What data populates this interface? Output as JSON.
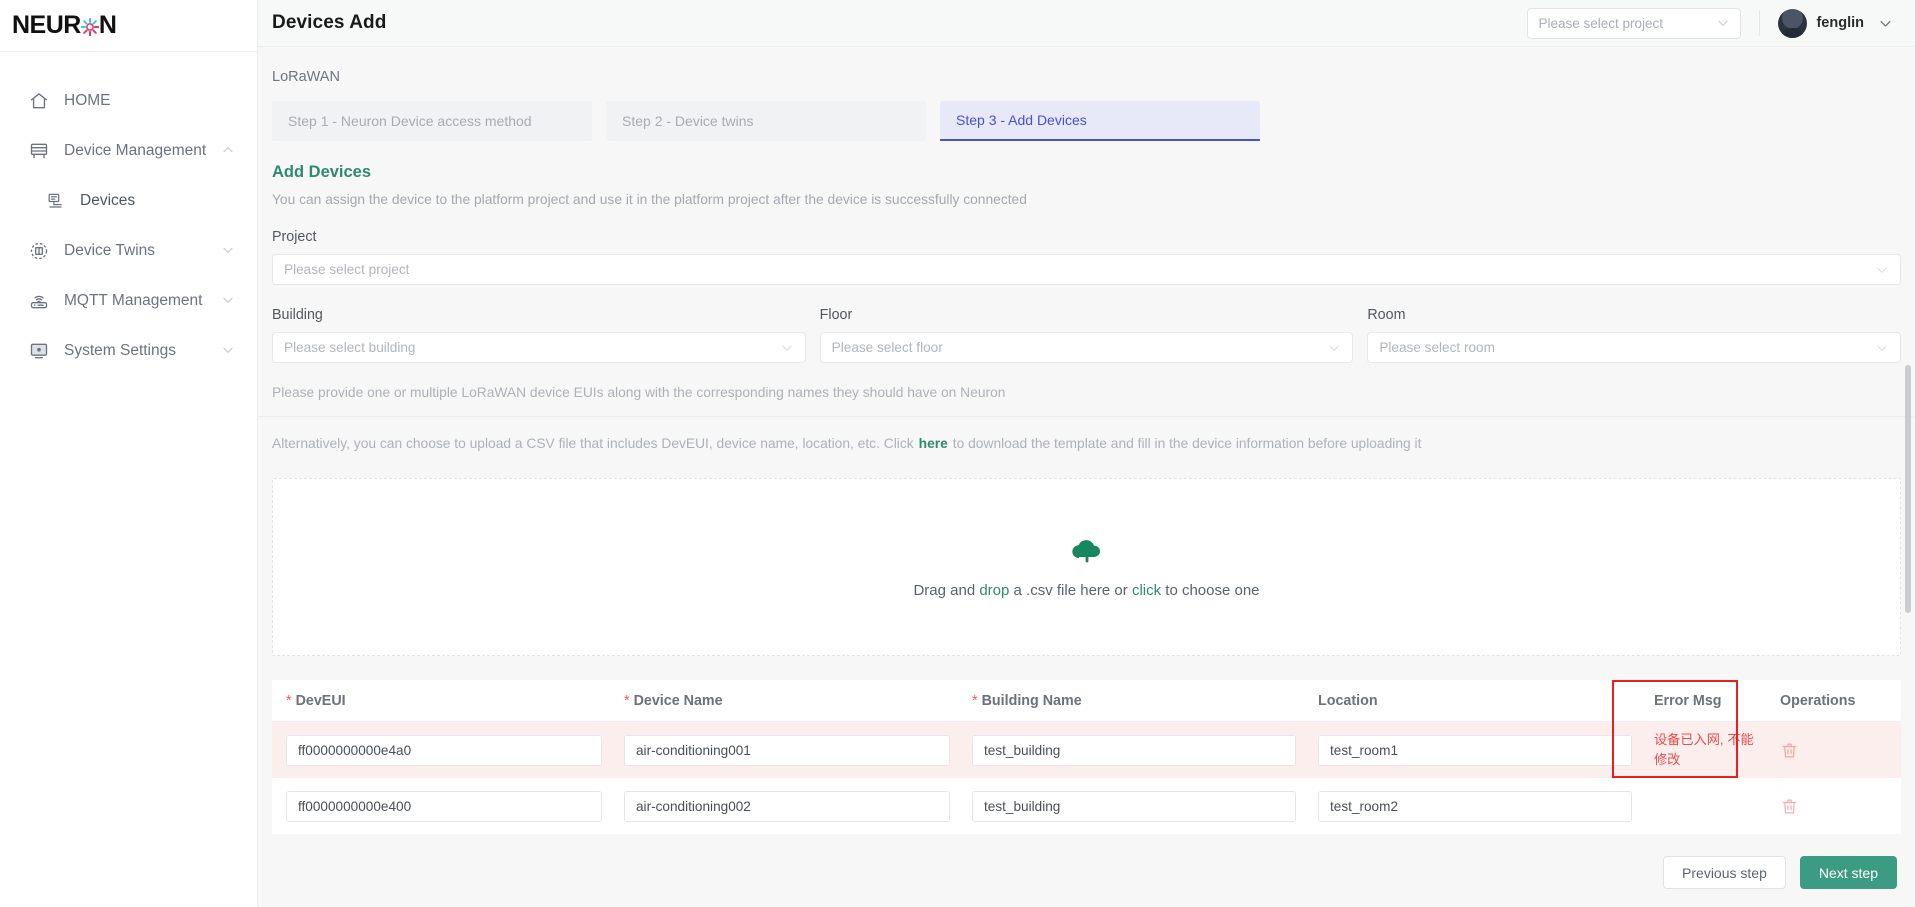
{
  "brand": {
    "name_part1": "NEUR",
    "name_part2": "N",
    "spark_icon": "gear-spark-icon"
  },
  "sidebar": {
    "items": [
      {
        "label": "HOME",
        "icon": "home-icon",
        "expandable": false,
        "sub": false
      },
      {
        "label": "Device Management",
        "icon": "device-management-icon",
        "expandable": true,
        "chevron": "chevron-up-icon",
        "sub": false
      },
      {
        "label": "Devices",
        "icon": "devices-icon",
        "expandable": false,
        "sub": true
      },
      {
        "label": "Device Twins",
        "icon": "device-twins-icon",
        "expandable": true,
        "chevron": "chevron-down-icon",
        "sub": false
      },
      {
        "label": "MQTT Management",
        "icon": "mqtt-icon",
        "expandable": true,
        "chevron": "chevron-down-icon",
        "sub": false
      },
      {
        "label": "System Settings",
        "icon": "system-settings-icon",
        "expandable": true,
        "chevron": "chevron-down-icon",
        "sub": false
      }
    ]
  },
  "topbar": {
    "title": "Devices Add",
    "project_select_placeholder": "Please select project",
    "project_select_value": "",
    "username": "fenglin",
    "chevron_icon": "chevron-down-icon",
    "avatar_icon": "avatar"
  },
  "breadcrumb": "LoRaWAN",
  "steps": [
    {
      "label": "Step 1 - Neuron Device access method",
      "active": false
    },
    {
      "label": "Step 2 - Device twins",
      "active": false
    },
    {
      "label": "Step 3 - Add Devices",
      "active": true
    }
  ],
  "section": {
    "title": "Add Devices",
    "subtitle": "You can assign the device to the platform project and use it in the platform project after the device is successfully connected"
  },
  "form": {
    "project": {
      "label": "Project",
      "placeholder": "Please select project",
      "value": ""
    },
    "building": {
      "label": "Building",
      "placeholder": "Please select building",
      "value": ""
    },
    "floor": {
      "label": "Floor",
      "placeholder": "Please select floor",
      "value": ""
    },
    "room": {
      "label": "Room",
      "placeholder": "Please select room",
      "value": ""
    }
  },
  "hints": {
    "line1": "Please provide one or multiple LoRaWAN device EUIs along with the corresponding names they should have on Neuron",
    "line2_before": "Alternatively, you can choose to upload a CSV file that includes DevEUI, device name, location, etc. Click",
    "line2_link": "here",
    "line2_after": "to download the template and fill in the device information before uploading it"
  },
  "dropzone": {
    "icon": "cloud-upload-icon",
    "text_part1": "Drag and ",
    "text_drop": "drop",
    "text_part2": " a .csv file here or ",
    "text_click": "click",
    "text_part3": " to choose one"
  },
  "table": {
    "columns": [
      {
        "label": "DevEUI",
        "required": true
      },
      {
        "label": "Device Name",
        "required": true
      },
      {
        "label": "Building Name",
        "required": true
      },
      {
        "label": "Location",
        "required": false
      },
      {
        "label": "Error Msg",
        "required": false
      },
      {
        "label": "Operations",
        "required": false
      }
    ],
    "rows": [
      {
        "deveui": "ff0000000000e4a0",
        "device_name": "air-conditioning001",
        "building_name": "test_building",
        "location": "test_room1",
        "error_msg": "设备已入网, 不能修改",
        "has_error": true,
        "delete_icon": "trash-icon"
      },
      {
        "deveui": "ff0000000000e400",
        "device_name": "air-conditioning002",
        "building_name": "test_building",
        "location": "test_room2",
        "error_msg": "",
        "has_error": false,
        "delete_icon": "trash-icon"
      }
    ]
  },
  "footer": {
    "previous_label": "Previous step",
    "next_label": "Next step"
  },
  "colors": {
    "brand_green": "#2e8b6f",
    "primary_button": "#3c9c82",
    "step_active": "#4a4fd0",
    "error_red": "#ef4b4b",
    "error_outline": "#e8201e",
    "error_row_bg": "#fdeeee"
  }
}
